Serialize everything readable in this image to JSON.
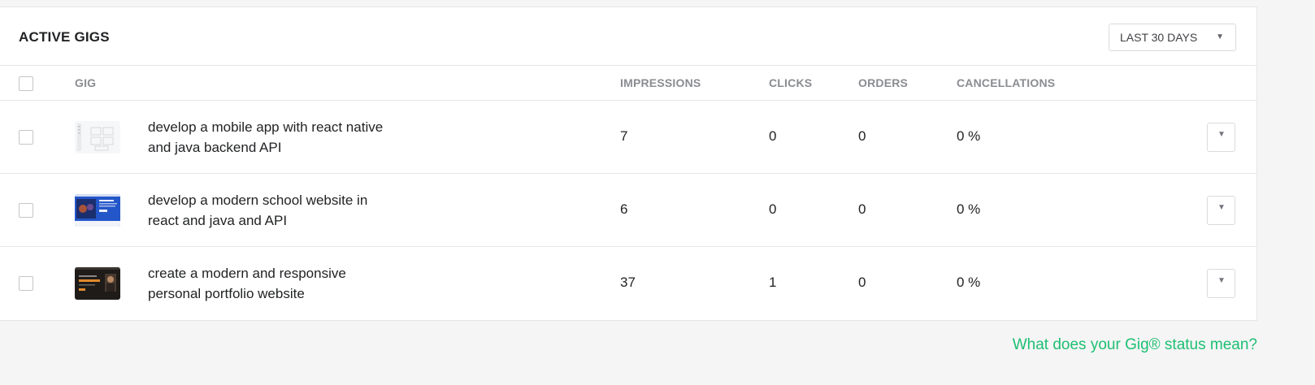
{
  "card": {
    "title": "ACTIVE GIGS",
    "period": {
      "selected": "LAST 30 DAYS",
      "caret": "▼"
    }
  },
  "table": {
    "columns": {
      "gig": "GIG",
      "impressions": "IMPRESSIONS",
      "clicks": "CLICKS",
      "orders": "ORDERS",
      "cancellations": "CANCELLATIONS"
    },
    "rows": [
      {
        "title_line1": "develop a mobile app with react native",
        "title_line2": "and java backend API",
        "impressions": "7",
        "clicks": "0",
        "orders": "0",
        "cancellations": "0 %",
        "thumb_icon": "wireframe-thumbnail"
      },
      {
        "title_line1": "develop a modern school website in",
        "title_line2": "react and java and API",
        "impressions": "6",
        "clicks": "0",
        "orders": "0",
        "cancellations": "0 %",
        "thumb_icon": "blue-website-thumbnail"
      },
      {
        "title_line1": "create a modern and responsive",
        "title_line2": "personal portfolio website",
        "impressions": "37",
        "clicks": "1",
        "orders": "0",
        "cancellations": "0 %",
        "thumb_icon": "dark-portfolio-thumbnail"
      }
    ],
    "row_menu_caret": "▼"
  },
  "footer": {
    "status_link": "What does your Gig® status mean?"
  },
  "colors": {
    "accent_green": "#1dbf73",
    "header_gray": "#8a8c91",
    "border": "#e4e5e7",
    "background": "#f5f5f5"
  }
}
